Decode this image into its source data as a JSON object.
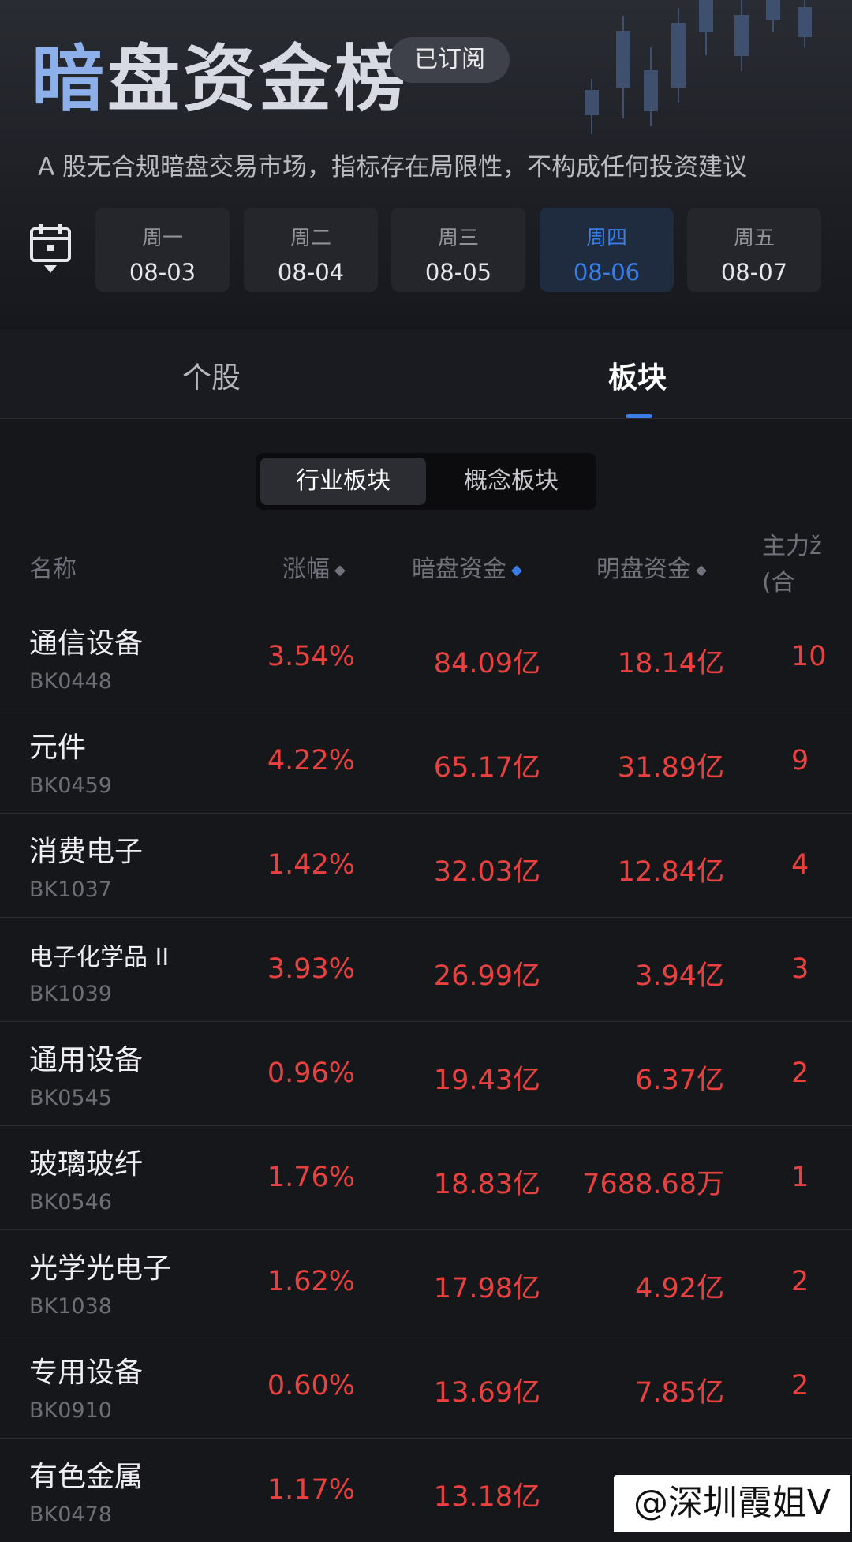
{
  "header": {
    "title": "暗盘资金榜",
    "subscribe_badge": "已订阅",
    "disclaimer": "A 股无合规暗盘交易市场，指标存在局限性，不构成任何投资建议"
  },
  "dates": [
    {
      "weekday": "周一",
      "date": "08-03"
    },
    {
      "weekday": "周二",
      "date": "08-04"
    },
    {
      "weekday": "周三",
      "date": "08-05"
    },
    {
      "weekday": "周四",
      "date": "08-06",
      "selected": true
    },
    {
      "weekday": "周五",
      "date": "08-07"
    }
  ],
  "tabs": [
    {
      "label": "个股"
    },
    {
      "label": "板块",
      "active": true
    }
  ],
  "segment": {
    "industry": "行业板块",
    "concept": "概念板块"
  },
  "table": {
    "headers": {
      "name": "名称",
      "change": "涨幅",
      "dark_fund": "暗盘资金",
      "lit_fund": "明盘资金",
      "main_line1": "主力ž",
      "main_line2": "(合"
    },
    "rows": [
      {
        "name": "通信设备",
        "code": "BK0448",
        "change": "3.54%",
        "dark": "84.09亿",
        "lit": "18.14亿",
        "main": "10"
      },
      {
        "name": "元件",
        "code": "BK0459",
        "change": "4.22%",
        "dark": "65.17亿",
        "lit": "31.89亿",
        "main": "9"
      },
      {
        "name": "消费电子",
        "code": "BK1037",
        "change": "1.42%",
        "dark": "32.03亿",
        "lit": "12.84亿",
        "main": "4"
      },
      {
        "name": "电子化学品 II",
        "code": "BK1039",
        "change": "3.93%",
        "dark": "26.99亿",
        "lit": "3.94亿",
        "main": "3"
      },
      {
        "name": "通用设备",
        "code": "BK0545",
        "change": "0.96%",
        "dark": "19.43亿",
        "lit": "6.37亿",
        "main": "2"
      },
      {
        "name": "玻璃玻纤",
        "code": "BK0546",
        "change": "1.76%",
        "dark": "18.83亿",
        "lit": "7688.68万",
        "main": "1"
      },
      {
        "name": "光学光电子",
        "code": "BK1038",
        "change": "1.62%",
        "dark": "17.98亿",
        "lit": "4.92亿",
        "main": "2"
      },
      {
        "name": "专用设备",
        "code": "BK0910",
        "change": "0.60%",
        "dark": "13.69亿",
        "lit": "7.85亿",
        "main": "2"
      },
      {
        "name": "有色金属",
        "code": "BK0478",
        "change": "1.17%",
        "dark": "13.18亿",
        "lit": "",
        "main": ""
      }
    ]
  },
  "watermark": "@深圳霞姐V",
  "colors": {
    "accent": "#3a7de6",
    "up": "#e8413f",
    "background": "#16171b"
  }
}
